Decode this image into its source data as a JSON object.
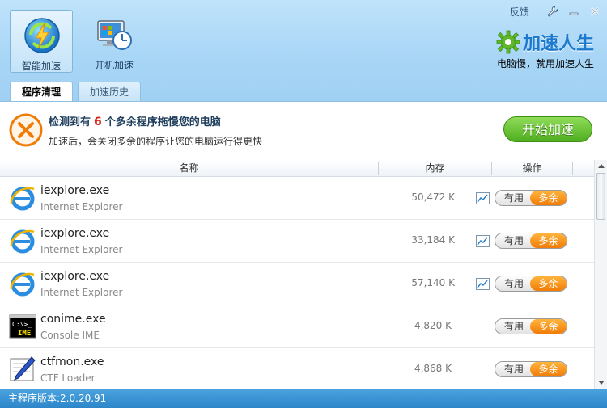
{
  "header": {
    "nav": [
      {
        "label": "智能加速",
        "icon": "lightning-speed-icon",
        "active": true
      },
      {
        "label": "开机加速",
        "icon": "monitor-clock-icon",
        "active": false
      }
    ],
    "feedback_label": "反馈",
    "controls": [
      "wrench-icon",
      "minimize-icon",
      "close-icon"
    ]
  },
  "brand": {
    "name": "加速人生",
    "slogan": "电脑慢，就用加速人生",
    "icon": "gear-logo-icon"
  },
  "tabs": [
    {
      "label": "程序清理",
      "active": true
    },
    {
      "label": "加速历史",
      "active": false
    }
  ],
  "alert": {
    "icon": "warning-x-icon",
    "headline_prefix": "检测到有",
    "count": "6",
    "headline_suffix": "个多余程序拖慢您的电脑",
    "subtext": "加速后，会关闭多余的程序让您的电脑运行得更快",
    "start_button": "开始加速"
  },
  "table": {
    "columns": [
      "名称",
      "内存",
      "操作"
    ],
    "rows": [
      {
        "name": "iexplore.exe",
        "desc": "Internet Explorer",
        "memory": "50,472 K",
        "icon": "ie-icon",
        "chart": true,
        "useful_label": "有用",
        "extra_label": "多余"
      },
      {
        "name": "iexplore.exe",
        "desc": "Internet Explorer",
        "memory": "33,184 K",
        "icon": "ie-icon",
        "chart": true,
        "useful_label": "有用",
        "extra_label": "多余"
      },
      {
        "name": "iexplore.exe",
        "desc": "Internet Explorer",
        "memory": "57,140 K",
        "icon": "ie-icon",
        "chart": true,
        "useful_label": "有用",
        "extra_label": "多余"
      },
      {
        "name": "conime.exe",
        "desc": "Console IME",
        "memory": "4,820 K",
        "icon": "console-ime-icon",
        "chart": false,
        "useful_label": "有用",
        "extra_label": "多余"
      },
      {
        "name": "ctfmon.exe",
        "desc": "CTF Loader",
        "memory": "4,868 K",
        "icon": "ctf-pen-icon",
        "chart": false,
        "useful_label": "有用",
        "extra_label": "多余"
      }
    ]
  },
  "status": {
    "version_text": "主程序版本:2.0.20.91"
  },
  "colors": {
    "accent": "#1c79cc",
    "start_green": "#5bb82a",
    "extra_orange": "#f28a0f",
    "status_blue": "#3a95d6",
    "alert_count_red": "#d9241a"
  }
}
